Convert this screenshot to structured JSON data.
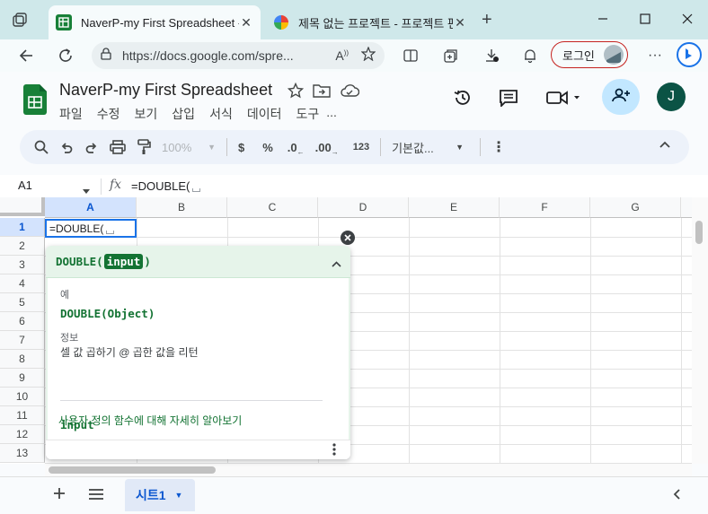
{
  "browser": {
    "active_tab_title": "NaverP-my First Spreadsheet - G",
    "inactive_tab_title": "제목 없는 프로젝트 - 프로젝트 편",
    "url": "https://docs.google.com/spre...",
    "login_label": "로그인"
  },
  "doc": {
    "title": "NaverP-my First Spreadsheet",
    "menus": [
      "파일",
      "수정",
      "보기",
      "삽입",
      "서식",
      "데이터",
      "도구",
      "..."
    ],
    "avatar_initial": "J"
  },
  "toolbar": {
    "zoom": "100%",
    "currency": "$",
    "percent": "%",
    "decimal_decrease": ".0",
    "decimal_increase": ".00",
    "number_format": "123",
    "font": "기본값..."
  },
  "formula_bar": {
    "name_box": "A1",
    "fx": "fx",
    "formula": "=DOUBLE("
  },
  "grid": {
    "columns": [
      "A",
      "B",
      "C",
      "D",
      "E",
      "F",
      "G"
    ],
    "rows": [
      "1",
      "2",
      "3",
      "4",
      "5",
      "6",
      "7",
      "8",
      "9",
      "10",
      "11",
      "12",
      "13"
    ],
    "active_cell_value": "=DOUBLE("
  },
  "help": {
    "fn_name": "DOUBLE(",
    "fn_arg": "input",
    "fn_close": ")",
    "example_label": "예",
    "example": "DOUBLE(Object)",
    "about_label": "정보",
    "about_text": "셀 값 곱하기 @ 곱한 값을 리턴",
    "param": "input",
    "learn_more": "사용자 정의 함수에 대해 자세히 알아보기"
  },
  "sheets": {
    "active_sheet": "시트1"
  },
  "colors": {
    "accent_green": "#137333",
    "selection_blue": "#1a73e8",
    "browser_frame": "#cfe8ea"
  }
}
